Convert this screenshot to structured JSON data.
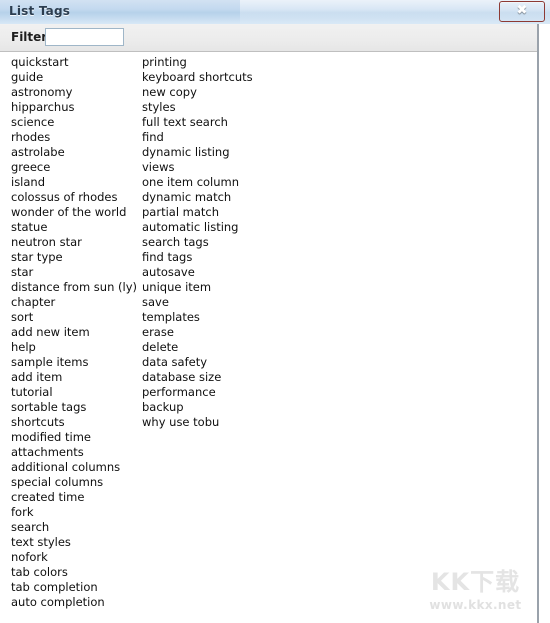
{
  "window": {
    "title": "List Tags",
    "close_label": "✖",
    "close_icon_name": "close-icon"
  },
  "filter": {
    "label": "Filter",
    "value": "",
    "placeholder": ""
  },
  "tags": {
    "column_1": [
      "quickstart",
      "guide",
      "astronomy",
      "hipparchus",
      "science",
      "rhodes",
      "astrolabe",
      "greece",
      "island",
      "colossus of rhodes",
      "wonder of the world",
      "statue",
      "neutron star",
      "star type",
      "star",
      "distance from sun (ly)",
      "chapter",
      "sort",
      "add new item",
      "help",
      "sample items",
      "add item",
      "tutorial",
      "sortable tags",
      "shortcuts",
      "modified time",
      "attachments",
      "additional columns",
      "special columns",
      "created time",
      "fork",
      "search",
      "text styles",
      "nofork",
      "tab colors",
      "tab completion",
      "auto completion"
    ],
    "column_2": [
      "printing",
      "keyboard shortcuts",
      "new copy",
      "styles",
      "full text search",
      "find",
      "dynamic listing",
      "views",
      "one item column",
      "dynamic match",
      "partial match",
      "automatic listing",
      "search tags",
      "find tags",
      "autosave",
      "unique item",
      "save",
      "templates",
      "erase",
      "delete",
      "data safety",
      "database size",
      "performance",
      "backup",
      "why use tobu"
    ]
  },
  "watermark": {
    "logo": "KK下载",
    "url": "www.kkx.net"
  },
  "colors": {
    "titlebar_start": "#d2e2f2",
    "titlebar_end": "#d8e8f6",
    "close_red": "#bd3423",
    "filter_bar": "#ececec",
    "text": "#0f0f0f"
  }
}
